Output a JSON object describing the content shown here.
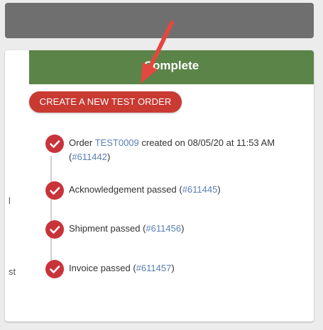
{
  "status": {
    "title": "Complete"
  },
  "actions": {
    "create_label": "CREATE A NEW TEST ORDER"
  },
  "timeline": {
    "events": [
      {
        "prefix": "Order ",
        "order_id": "TEST0009",
        "middle": " created on 08/05/20 at 11:53 AM",
        "paren_open": "(",
        "ref": "#611442",
        "paren_close": ")"
      },
      {
        "prefix": "Acknowledgement passed (",
        "ref": "#611445",
        "paren_close": ")"
      },
      {
        "prefix": "Shipment passed (",
        "ref": "#611456",
        "paren_close": ")"
      },
      {
        "prefix": "Invoice passed (",
        "ref": "#611457",
        "paren_close": ")"
      }
    ]
  },
  "edge_fragments": [
    "l",
    "st"
  ],
  "colors": {
    "header_green": "#5b8449",
    "button_red": "#c83a32",
    "check_red": "#c8343a",
    "link_blue": "#5a7fb4",
    "arrow_red": "#e4473f"
  },
  "icons": {
    "check": "check-circle-icon",
    "arrow": "annotation-arrow-icon"
  }
}
